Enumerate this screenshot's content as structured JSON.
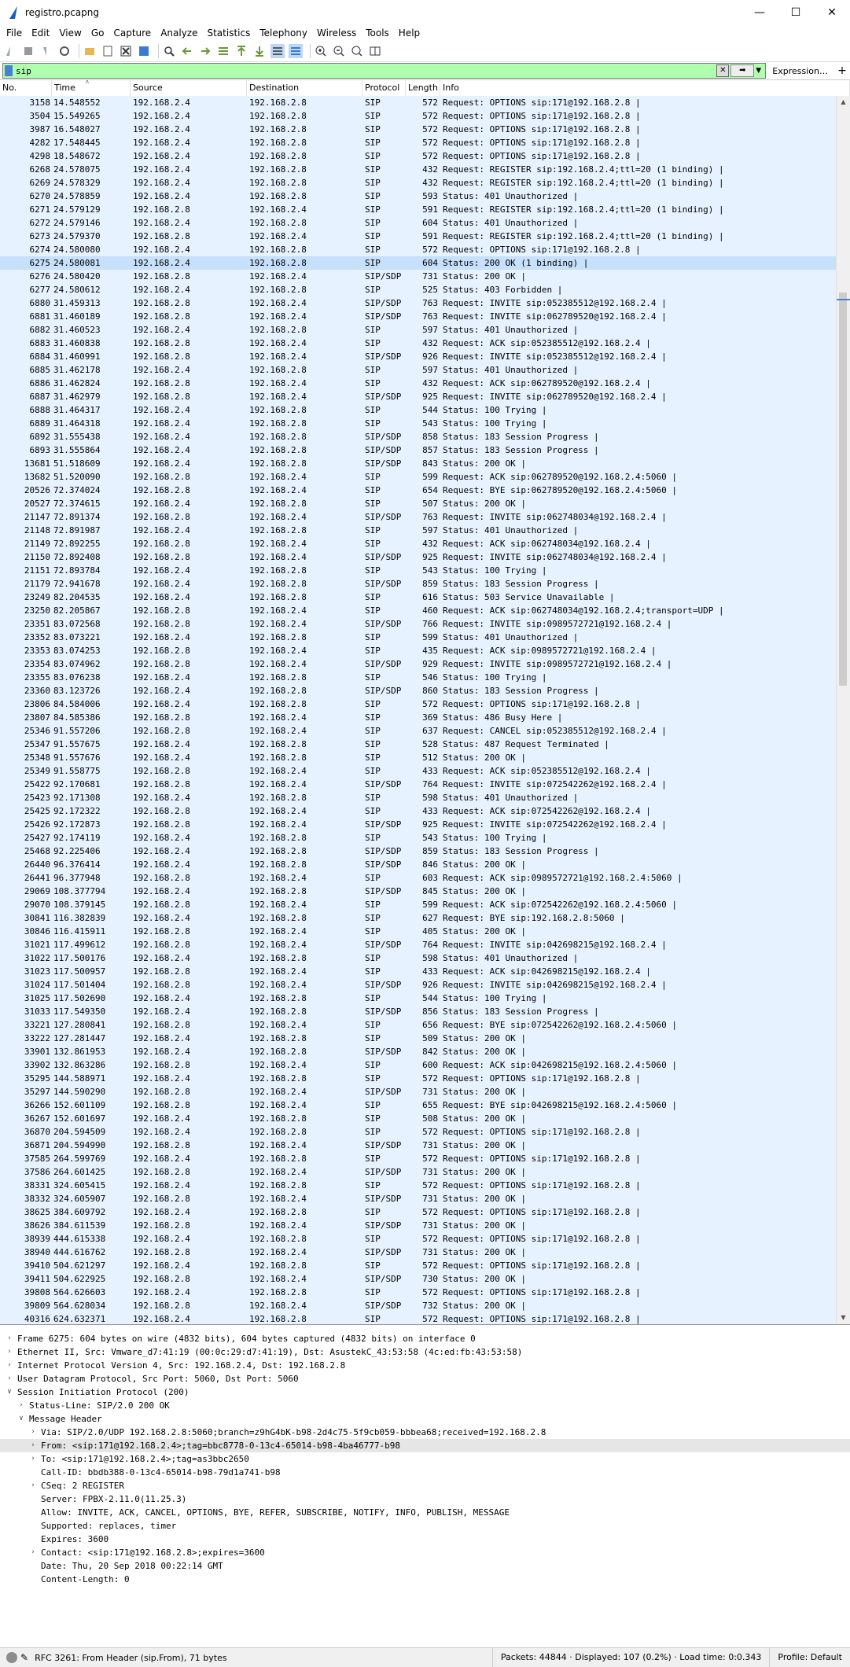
{
  "window": {
    "title": "registro.pcapng"
  },
  "menu": [
    "File",
    "Edit",
    "View",
    "Go",
    "Capture",
    "Analyze",
    "Statistics",
    "Telephony",
    "Wireless",
    "Tools",
    "Help"
  ],
  "filter": {
    "value": "sip",
    "expression_label": "Expression…"
  },
  "columns": [
    "No.",
    "Time",
    "Source",
    "Destination",
    "Protocol",
    "Length",
    "Info"
  ],
  "packets": [
    [
      "3158",
      "14.548552",
      "192.168.2.4",
      "192.168.2.8",
      "SIP",
      "572",
      "Request: OPTIONS sip:171@192.168.2.8 |"
    ],
    [
      "3504",
      "15.549265",
      "192.168.2.4",
      "192.168.2.8",
      "SIP",
      "572",
      "Request: OPTIONS sip:171@192.168.2.8 |"
    ],
    [
      "3987",
      "16.548027",
      "192.168.2.4",
      "192.168.2.8",
      "SIP",
      "572",
      "Request: OPTIONS sip:171@192.168.2.8 |"
    ],
    [
      "4282",
      "17.548445",
      "192.168.2.4",
      "192.168.2.8",
      "SIP",
      "572",
      "Request: OPTIONS sip:171@192.168.2.8 |"
    ],
    [
      "4298",
      "18.548672",
      "192.168.2.4",
      "192.168.2.8",
      "SIP",
      "572",
      "Request: OPTIONS sip:171@192.168.2.8 |"
    ],
    [
      "6268",
      "24.578075",
      "192.168.2.4",
      "192.168.2.8",
      "SIP",
      "432",
      "Request: REGISTER sip:192.168.2.4;ttl=20  (1 binding) |"
    ],
    [
      "6269",
      "24.578329",
      "192.168.2.4",
      "192.168.2.8",
      "SIP",
      "432",
      "Request: REGISTER sip:192.168.2.4;ttl=20  (1 binding) |"
    ],
    [
      "6270",
      "24.578859",
      "192.168.2.4",
      "192.168.2.8",
      "SIP",
      "593",
      "Status: 401 Unauthorized |"
    ],
    [
      "6271",
      "24.579129",
      "192.168.2.8",
      "192.168.2.4",
      "SIP",
      "591",
      "Request: REGISTER sip:192.168.2.4;ttl=20  (1 binding) |"
    ],
    [
      "6272",
      "24.579146",
      "192.168.2.4",
      "192.168.2.8",
      "SIP",
      "604",
      "Status: 401 Unauthorized |"
    ],
    [
      "6273",
      "24.579370",
      "192.168.2.8",
      "192.168.2.4",
      "SIP",
      "591",
      "Request: REGISTER sip:192.168.2.4;ttl=20  (1 binding) |"
    ],
    [
      "6274",
      "24.580080",
      "192.168.2.4",
      "192.168.2.8",
      "SIP",
      "572",
      "Request: OPTIONS sip:171@192.168.2.8 |"
    ],
    [
      "6275",
      "24.580081",
      "192.168.2.4",
      "192.168.2.8",
      "SIP",
      "604",
      "Status: 200 OK  (1 binding) |"
    ],
    [
      "6276",
      "24.580420",
      "192.168.2.8",
      "192.168.2.4",
      "SIP/SDP",
      "731",
      "Status: 200 OK |"
    ],
    [
      "6277",
      "24.580612",
      "192.168.2.4",
      "192.168.2.8",
      "SIP",
      "525",
      "Status: 403 Forbidden |"
    ],
    [
      "6880",
      "31.459313",
      "192.168.2.8",
      "192.168.2.4",
      "SIP/SDP",
      "763",
      "Request: INVITE sip:052385512@192.168.2.4 |"
    ],
    [
      "6881",
      "31.460189",
      "192.168.2.8",
      "192.168.2.4",
      "SIP/SDP",
      "763",
      "Request: INVITE sip:062789520@192.168.2.4 |"
    ],
    [
      "6882",
      "31.460523",
      "192.168.2.4",
      "192.168.2.8",
      "SIP",
      "597",
      "Status: 401 Unauthorized |"
    ],
    [
      "6883",
      "31.460838",
      "192.168.2.8",
      "192.168.2.4",
      "SIP",
      "432",
      "Request: ACK sip:052385512@192.168.2.4 |"
    ],
    [
      "6884",
      "31.460991",
      "192.168.2.8",
      "192.168.2.4",
      "SIP/SDP",
      "926",
      "Request: INVITE sip:052385512@192.168.2.4 |"
    ],
    [
      "6885",
      "31.462178",
      "192.168.2.4",
      "192.168.2.8",
      "SIP",
      "597",
      "Status: 401 Unauthorized |"
    ],
    [
      "6886",
      "31.462824",
      "192.168.2.8",
      "192.168.2.4",
      "SIP",
      "432",
      "Request: ACK sip:062789520@192.168.2.4 |"
    ],
    [
      "6887",
      "31.462979",
      "192.168.2.8",
      "192.168.2.4",
      "SIP/SDP",
      "925",
      "Request: INVITE sip:062789520@192.168.2.4 |"
    ],
    [
      "6888",
      "31.464317",
      "192.168.2.4",
      "192.168.2.8",
      "SIP",
      "544",
      "Status: 100 Trying |"
    ],
    [
      "6889",
      "31.464318",
      "192.168.2.4",
      "192.168.2.8",
      "SIP",
      "543",
      "Status: 100 Trying |"
    ],
    [
      "6892",
      "31.555438",
      "192.168.2.4",
      "192.168.2.8",
      "SIP/SDP",
      "858",
      "Status: 183 Session Progress |"
    ],
    [
      "6893",
      "31.555864",
      "192.168.2.4",
      "192.168.2.8",
      "SIP/SDP",
      "857",
      "Status: 183 Session Progress |"
    ],
    [
      "13681",
      "51.518609",
      "192.168.2.4",
      "192.168.2.8",
      "SIP/SDP",
      "843",
      "Status: 200 OK |"
    ],
    [
      "13682",
      "51.520090",
      "192.168.2.8",
      "192.168.2.4",
      "SIP",
      "599",
      "Request: ACK sip:062789520@192.168.2.4:5060 |"
    ],
    [
      "20526",
      "72.374024",
      "192.168.2.8",
      "192.168.2.4",
      "SIP",
      "654",
      "Request: BYE sip:062789520@192.168.2.4:5060 |"
    ],
    [
      "20527",
      "72.374615",
      "192.168.2.4",
      "192.168.2.8",
      "SIP",
      "507",
      "Status: 200 OK |"
    ],
    [
      "21147",
      "72.891374",
      "192.168.2.8",
      "192.168.2.4",
      "SIP/SDP",
      "763",
      "Request: INVITE sip:062748034@192.168.2.4 |"
    ],
    [
      "21148",
      "72.891987",
      "192.168.2.4",
      "192.168.2.8",
      "SIP",
      "597",
      "Status: 401 Unauthorized |"
    ],
    [
      "21149",
      "72.892255",
      "192.168.2.8",
      "192.168.2.4",
      "SIP",
      "432",
      "Request: ACK sip:062748034@192.168.2.4 |"
    ],
    [
      "21150",
      "72.892408",
      "192.168.2.8",
      "192.168.2.4",
      "SIP/SDP",
      "925",
      "Request: INVITE sip:062748034@192.168.2.4 |"
    ],
    [
      "21151",
      "72.893784",
      "192.168.2.4",
      "192.168.2.8",
      "SIP",
      "543",
      "Status: 100 Trying |"
    ],
    [
      "21179",
      "72.941678",
      "192.168.2.4",
      "192.168.2.8",
      "SIP/SDP",
      "859",
      "Status: 183 Session Progress |"
    ],
    [
      "23249",
      "82.204535",
      "192.168.2.4",
      "192.168.2.8",
      "SIP",
      "616",
      "Status: 503 Service Unavailable |"
    ],
    [
      "23250",
      "82.205867",
      "192.168.2.8",
      "192.168.2.4",
      "SIP",
      "460",
      "Request: ACK sip:062748034@192.168.2.4;transport=UDP |"
    ],
    [
      "23351",
      "83.072568",
      "192.168.2.8",
      "192.168.2.4",
      "SIP/SDP",
      "766",
      "Request: INVITE sip:0989572721@192.168.2.4 |"
    ],
    [
      "23352",
      "83.073221",
      "192.168.2.4",
      "192.168.2.8",
      "SIP",
      "599",
      "Status: 401 Unauthorized |"
    ],
    [
      "23353",
      "83.074253",
      "192.168.2.8",
      "192.168.2.4",
      "SIP",
      "435",
      "Request: ACK sip:0989572721@192.168.2.4 |"
    ],
    [
      "23354",
      "83.074962",
      "192.168.2.8",
      "192.168.2.4",
      "SIP/SDP",
      "929",
      "Request: INVITE sip:0989572721@192.168.2.4 |"
    ],
    [
      "23355",
      "83.076238",
      "192.168.2.4",
      "192.168.2.8",
      "SIP",
      "546",
      "Status: 100 Trying |"
    ],
    [
      "23360",
      "83.123726",
      "192.168.2.4",
      "192.168.2.8",
      "SIP/SDP",
      "860",
      "Status: 183 Session Progress |"
    ],
    [
      "23806",
      "84.584006",
      "192.168.2.4",
      "192.168.2.8",
      "SIP",
      "572",
      "Request: OPTIONS sip:171@192.168.2.8 |"
    ],
    [
      "23807",
      "84.585386",
      "192.168.2.8",
      "192.168.2.4",
      "SIP",
      "369",
      "Status: 486 Busy Here |"
    ],
    [
      "25346",
      "91.557206",
      "192.168.2.8",
      "192.168.2.4",
      "SIP",
      "637",
      "Request: CANCEL sip:052385512@192.168.2.4 |"
    ],
    [
      "25347",
      "91.557675",
      "192.168.2.4",
      "192.168.2.8",
      "SIP",
      "528",
      "Status: 487 Request Terminated |"
    ],
    [
      "25348",
      "91.557676",
      "192.168.2.4",
      "192.168.2.8",
      "SIP",
      "512",
      "Status: 200 OK |"
    ],
    [
      "25349",
      "91.558775",
      "192.168.2.8",
      "192.168.2.4",
      "SIP",
      "433",
      "Request: ACK sip:052385512@192.168.2.4 |"
    ],
    [
      "25422",
      "92.170681",
      "192.168.2.8",
      "192.168.2.4",
      "SIP/SDP",
      "764",
      "Request: INVITE sip:072542262@192.168.2.4 |"
    ],
    [
      "25423",
      "92.171308",
      "192.168.2.4",
      "192.168.2.8",
      "SIP",
      "598",
      "Status: 401 Unauthorized |"
    ],
    [
      "25425",
      "92.172322",
      "192.168.2.8",
      "192.168.2.4",
      "SIP",
      "433",
      "Request: ACK sip:072542262@192.168.2.4 |"
    ],
    [
      "25426",
      "92.172873",
      "192.168.2.8",
      "192.168.2.4",
      "SIP/SDP",
      "925",
      "Request: INVITE sip:072542262@192.168.2.4 |"
    ],
    [
      "25427",
      "92.174119",
      "192.168.2.4",
      "192.168.2.8",
      "SIP",
      "543",
      "Status: 100 Trying |"
    ],
    [
      "25468",
      "92.225406",
      "192.168.2.4",
      "192.168.2.8",
      "SIP/SDP",
      "859",
      "Status: 183 Session Progress |"
    ],
    [
      "26440",
      "96.376414",
      "192.168.2.4",
      "192.168.2.8",
      "SIP/SDP",
      "846",
      "Status: 200 OK |"
    ],
    [
      "26441",
      "96.377948",
      "192.168.2.8",
      "192.168.2.4",
      "SIP",
      "603",
      "Request: ACK sip:0989572721@192.168.2.4:5060 |"
    ],
    [
      "29069",
      "108.377794",
      "192.168.2.4",
      "192.168.2.8",
      "SIP/SDP",
      "845",
      "Status: 200 OK |"
    ],
    [
      "29070",
      "108.379145",
      "192.168.2.8",
      "192.168.2.4",
      "SIP",
      "599",
      "Request: ACK sip:072542262@192.168.2.4:5060 |"
    ],
    [
      "30841",
      "116.382839",
      "192.168.2.4",
      "192.168.2.8",
      "SIP",
      "627",
      "Request: BYE sip:192.168.2.8:5060 |"
    ],
    [
      "30846",
      "116.415911",
      "192.168.2.8",
      "192.168.2.4",
      "SIP",
      "405",
      "Status: 200 OK |"
    ],
    [
      "31021",
      "117.499612",
      "192.168.2.8",
      "192.168.2.4",
      "SIP/SDP",
      "764",
      "Request: INVITE sip:042698215@192.168.2.4 |"
    ],
    [
      "31022",
      "117.500176",
      "192.168.2.4",
      "192.168.2.8",
      "SIP",
      "598",
      "Status: 401 Unauthorized |"
    ],
    [
      "31023",
      "117.500957",
      "192.168.2.8",
      "192.168.2.4",
      "SIP",
      "433",
      "Request: ACK sip:042698215@192.168.2.4 |"
    ],
    [
      "31024",
      "117.501404",
      "192.168.2.8",
      "192.168.2.4",
      "SIP/SDP",
      "926",
      "Request: INVITE sip:042698215@192.168.2.4 |"
    ],
    [
      "31025",
      "117.502690",
      "192.168.2.4",
      "192.168.2.8",
      "SIP",
      "544",
      "Status: 100 Trying |"
    ],
    [
      "31033",
      "117.549350",
      "192.168.2.4",
      "192.168.2.8",
      "SIP/SDP",
      "856",
      "Status: 183 Session Progress |"
    ],
    [
      "33221",
      "127.280841",
      "192.168.2.8",
      "192.168.2.4",
      "SIP",
      "656",
      "Request: BYE sip:072542262@192.168.2.4:5060 |"
    ],
    [
      "33222",
      "127.281447",
      "192.168.2.4",
      "192.168.2.8",
      "SIP",
      "509",
      "Status: 200 OK |"
    ],
    [
      "33901",
      "132.861953",
      "192.168.2.4",
      "192.168.2.8",
      "SIP/SDP",
      "842",
      "Status: 200 OK |"
    ],
    [
      "33902",
      "132.863286",
      "192.168.2.8",
      "192.168.2.4",
      "SIP",
      "600",
      "Request: ACK sip:042698215@192.168.2.4:5060 |"
    ],
    [
      "35295",
      "144.588971",
      "192.168.2.4",
      "192.168.2.8",
      "SIP",
      "572",
      "Request: OPTIONS sip:171@192.168.2.8 |"
    ],
    [
      "35297",
      "144.590290",
      "192.168.2.8",
      "192.168.2.4",
      "SIP/SDP",
      "731",
      "Status: 200 OK |"
    ],
    [
      "36266",
      "152.601109",
      "192.168.2.8",
      "192.168.2.4",
      "SIP",
      "655",
      "Request: BYE sip:042698215@192.168.2.4:5060 |"
    ],
    [
      "36267",
      "152.601697",
      "192.168.2.4",
      "192.168.2.8",
      "SIP",
      "508",
      "Status: 200 OK |"
    ],
    [
      "36870",
      "204.594509",
      "192.168.2.4",
      "192.168.2.8",
      "SIP",
      "572",
      "Request: OPTIONS sip:171@192.168.2.8 |"
    ],
    [
      "36871",
      "204.594990",
      "192.168.2.8",
      "192.168.2.4",
      "SIP/SDP",
      "731",
      "Status: 200 OK |"
    ],
    [
      "37585",
      "264.599769",
      "192.168.2.4",
      "192.168.2.8",
      "SIP",
      "572",
      "Request: OPTIONS sip:171@192.168.2.8 |"
    ],
    [
      "37586",
      "264.601425",
      "192.168.2.8",
      "192.168.2.4",
      "SIP/SDP",
      "731",
      "Status: 200 OK |"
    ],
    [
      "38331",
      "324.605415",
      "192.168.2.4",
      "192.168.2.8",
      "SIP",
      "572",
      "Request: OPTIONS sip:171@192.168.2.8 |"
    ],
    [
      "38332",
      "324.605907",
      "192.168.2.8",
      "192.168.2.4",
      "SIP/SDP",
      "731",
      "Status: 200 OK |"
    ],
    [
      "38625",
      "384.609792",
      "192.168.2.4",
      "192.168.2.8",
      "SIP",
      "572",
      "Request: OPTIONS sip:171@192.168.2.8 |"
    ],
    [
      "38626",
      "384.611539",
      "192.168.2.8",
      "192.168.2.4",
      "SIP/SDP",
      "731",
      "Status: 200 OK |"
    ],
    [
      "38939",
      "444.615338",
      "192.168.2.4",
      "192.168.2.8",
      "SIP",
      "572",
      "Request: OPTIONS sip:171@192.168.2.8 |"
    ],
    [
      "38940",
      "444.616762",
      "192.168.2.8",
      "192.168.2.4",
      "SIP/SDP",
      "731",
      "Status: 200 OK |"
    ],
    [
      "39410",
      "504.621297",
      "192.168.2.4",
      "192.168.2.8",
      "SIP",
      "572",
      "Request: OPTIONS sip:171@192.168.2.8 |"
    ],
    [
      "39411",
      "504.622925",
      "192.168.2.8",
      "192.168.2.4",
      "SIP/SDP",
      "730",
      "Status: 200 OK |"
    ],
    [
      "39808",
      "564.626603",
      "192.168.2.4",
      "192.168.2.8",
      "SIP",
      "572",
      "Request: OPTIONS sip:171@192.168.2.8 |"
    ],
    [
      "39809",
      "564.628034",
      "192.168.2.8",
      "192.168.2.4",
      "SIP/SDP",
      "732",
      "Status: 200 OK |"
    ],
    [
      "40316",
      "624.632371",
      "192.168.2.4",
      "192.168.2.8",
      "SIP",
      "572",
      "Request: OPTIONS sip:171@192.168.2.8 |"
    ]
  ],
  "selected_packet": "6275",
  "details": [
    {
      "indent": 0,
      "arrow": "closed",
      "text": "Frame 6275: 604 bytes on wire (4832 bits), 604 bytes captured (4832 bits) on interface 0"
    },
    {
      "indent": 0,
      "arrow": "closed",
      "text": "Ethernet II, Src: Vmware_d7:41:19 (00:0c:29:d7:41:19), Dst: AsustekC_43:53:58 (4c:ed:fb:43:53:58)"
    },
    {
      "indent": 0,
      "arrow": "closed",
      "text": "Internet Protocol Version 4, Src: 192.168.2.4, Dst: 192.168.2.8"
    },
    {
      "indent": 0,
      "arrow": "closed",
      "text": "User Datagram Protocol, Src Port: 5060, Dst Port: 5060"
    },
    {
      "indent": 0,
      "arrow": "open",
      "text": "Session Initiation Protocol (200)"
    },
    {
      "indent": 1,
      "arrow": "closed",
      "text": "Status-Line: SIP/2.0 200 OK"
    },
    {
      "indent": 1,
      "arrow": "open",
      "text": "Message Header"
    },
    {
      "indent": 2,
      "arrow": "closed",
      "text": "Via: SIP/2.0/UDP 192.168.2.8:5060;branch=z9hG4bK-b98-2d4c75-5f9cb059-bbbea68;received=192.168.2.8"
    },
    {
      "indent": 2,
      "arrow": "closed",
      "text": "From: <sip:171@192.168.2.4>;tag=bbc8778-0-13c4-65014-b98-4ba46777-b98",
      "highlight": true
    },
    {
      "indent": 2,
      "arrow": "closed",
      "text": "To: <sip:171@192.168.2.4>;tag=as3bbc2650"
    },
    {
      "indent": 2,
      "arrow": "none",
      "text": "Call-ID: bbdb388-0-13c4-65014-b98-79d1a741-b98"
    },
    {
      "indent": 2,
      "arrow": "closed",
      "text": "CSeq: 2 REGISTER"
    },
    {
      "indent": 2,
      "arrow": "none",
      "text": "Server: FPBX-2.11.0(11.25.3)"
    },
    {
      "indent": 2,
      "arrow": "none",
      "text": "Allow: INVITE, ACK, CANCEL, OPTIONS, BYE, REFER, SUBSCRIBE, NOTIFY, INFO, PUBLISH, MESSAGE"
    },
    {
      "indent": 2,
      "arrow": "none",
      "text": "Supported: replaces, timer"
    },
    {
      "indent": 2,
      "arrow": "none",
      "text": "Expires: 3600"
    },
    {
      "indent": 2,
      "arrow": "closed",
      "text": "Contact: <sip:171@192.168.2.8>;expires=3600"
    },
    {
      "indent": 2,
      "arrow": "none",
      "text": "Date: Thu, 20 Sep 2018 00:22:14 GMT"
    },
    {
      "indent": 2,
      "arrow": "none",
      "text": "Content-Length: 0"
    }
  ],
  "status": {
    "field": "RFC 3261: From Header (sip.From), 71 bytes",
    "packets": "Packets: 44844 · Displayed: 107 (0.2%) · Load time: 0:0.343",
    "profile": "Profile: Default"
  },
  "colors": {
    "row_bg": "#e6f2ff",
    "selected_bg": "#c7e0fb",
    "filter_bg": "#afffaf"
  }
}
